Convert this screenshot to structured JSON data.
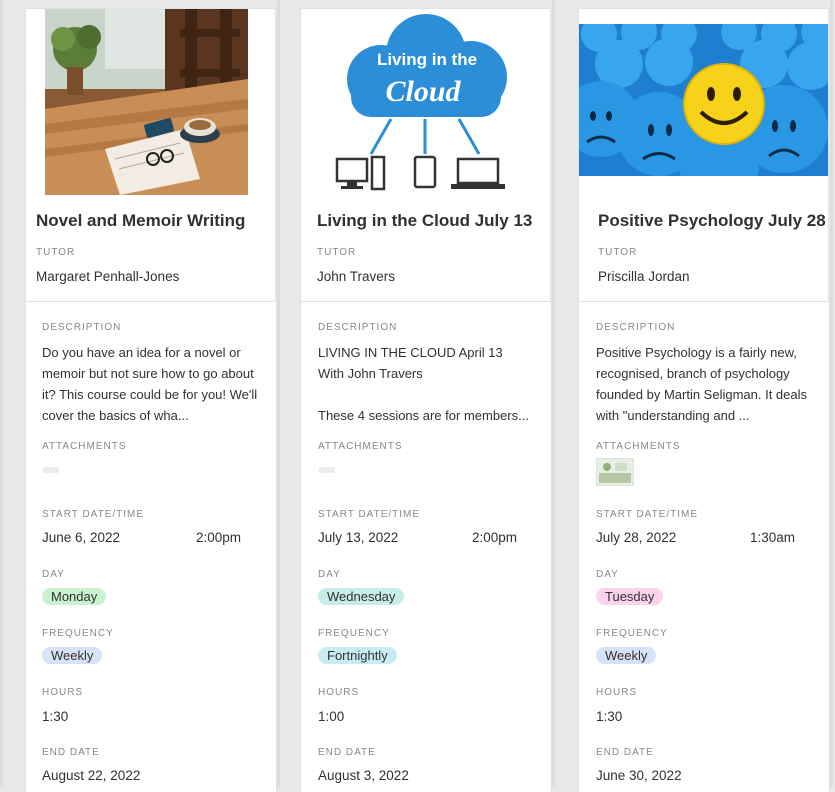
{
  "labels": {
    "tutor": "TUTOR",
    "description": "DESCRIPTION",
    "attachments": "ATTACHMENTS",
    "start": "START DATE/TIME",
    "day": "DAY",
    "frequency": "FREQUENCY",
    "hours": "HOURS",
    "end": "END DATE"
  },
  "cards": [
    {
      "title": "Novel and Memoir Writing",
      "tutor": "Margaret Penhall-Jones",
      "description": "Do you have an idea for a novel or memoir but not sure how to go about it? This course could be for you! We'll cover the basics of wha...",
      "start_date": "June 6, 2022",
      "start_time": "2:00pm",
      "day": "Monday",
      "day_color": "#c9f2cf",
      "frequency": "Weekly",
      "frequency_color": "#d6e2f7",
      "hours": "1:30",
      "end_date": "August 22, 2022",
      "image_icon": "desk-photo-image"
    },
    {
      "title": "Living in the Cloud July 13",
      "tutor": "John Travers",
      "description_line1": "LIVING IN THE CLOUD April 13",
      "description_line2": "With John Travers",
      "description_line3": "These 4 sessions are for members...",
      "start_date": "July 13, 2022",
      "start_time": "2:00pm",
      "day": "Wednesday",
      "day_color": "#c6eee9",
      "frequency": "Fortnightly",
      "frequency_color": "#c8ecf3",
      "hours": "1:00",
      "end_date": "August 3, 2022",
      "image_text_1": "Living in the",
      "image_text_2": "Cloud",
      "image_icon": "cloud-devices-image"
    },
    {
      "title": "Positive Psychology July 28",
      "tutor": "Priscilla Jordan",
      "description": "Positive Psychology is a fairly new, recognised, branch of psychology founded by Martin Seligman. It deals with \"understanding and ...",
      "start_date": "July 28, 2022",
      "start_time": "1:30am",
      "day": "Tuesday",
      "day_color": "#fbd3ec",
      "frequency": "Weekly",
      "frequency_color": "#d6e2f7",
      "hours": "1:30",
      "end_date": "June 30, 2022",
      "image_icon": "smiley-balls-image"
    }
  ]
}
